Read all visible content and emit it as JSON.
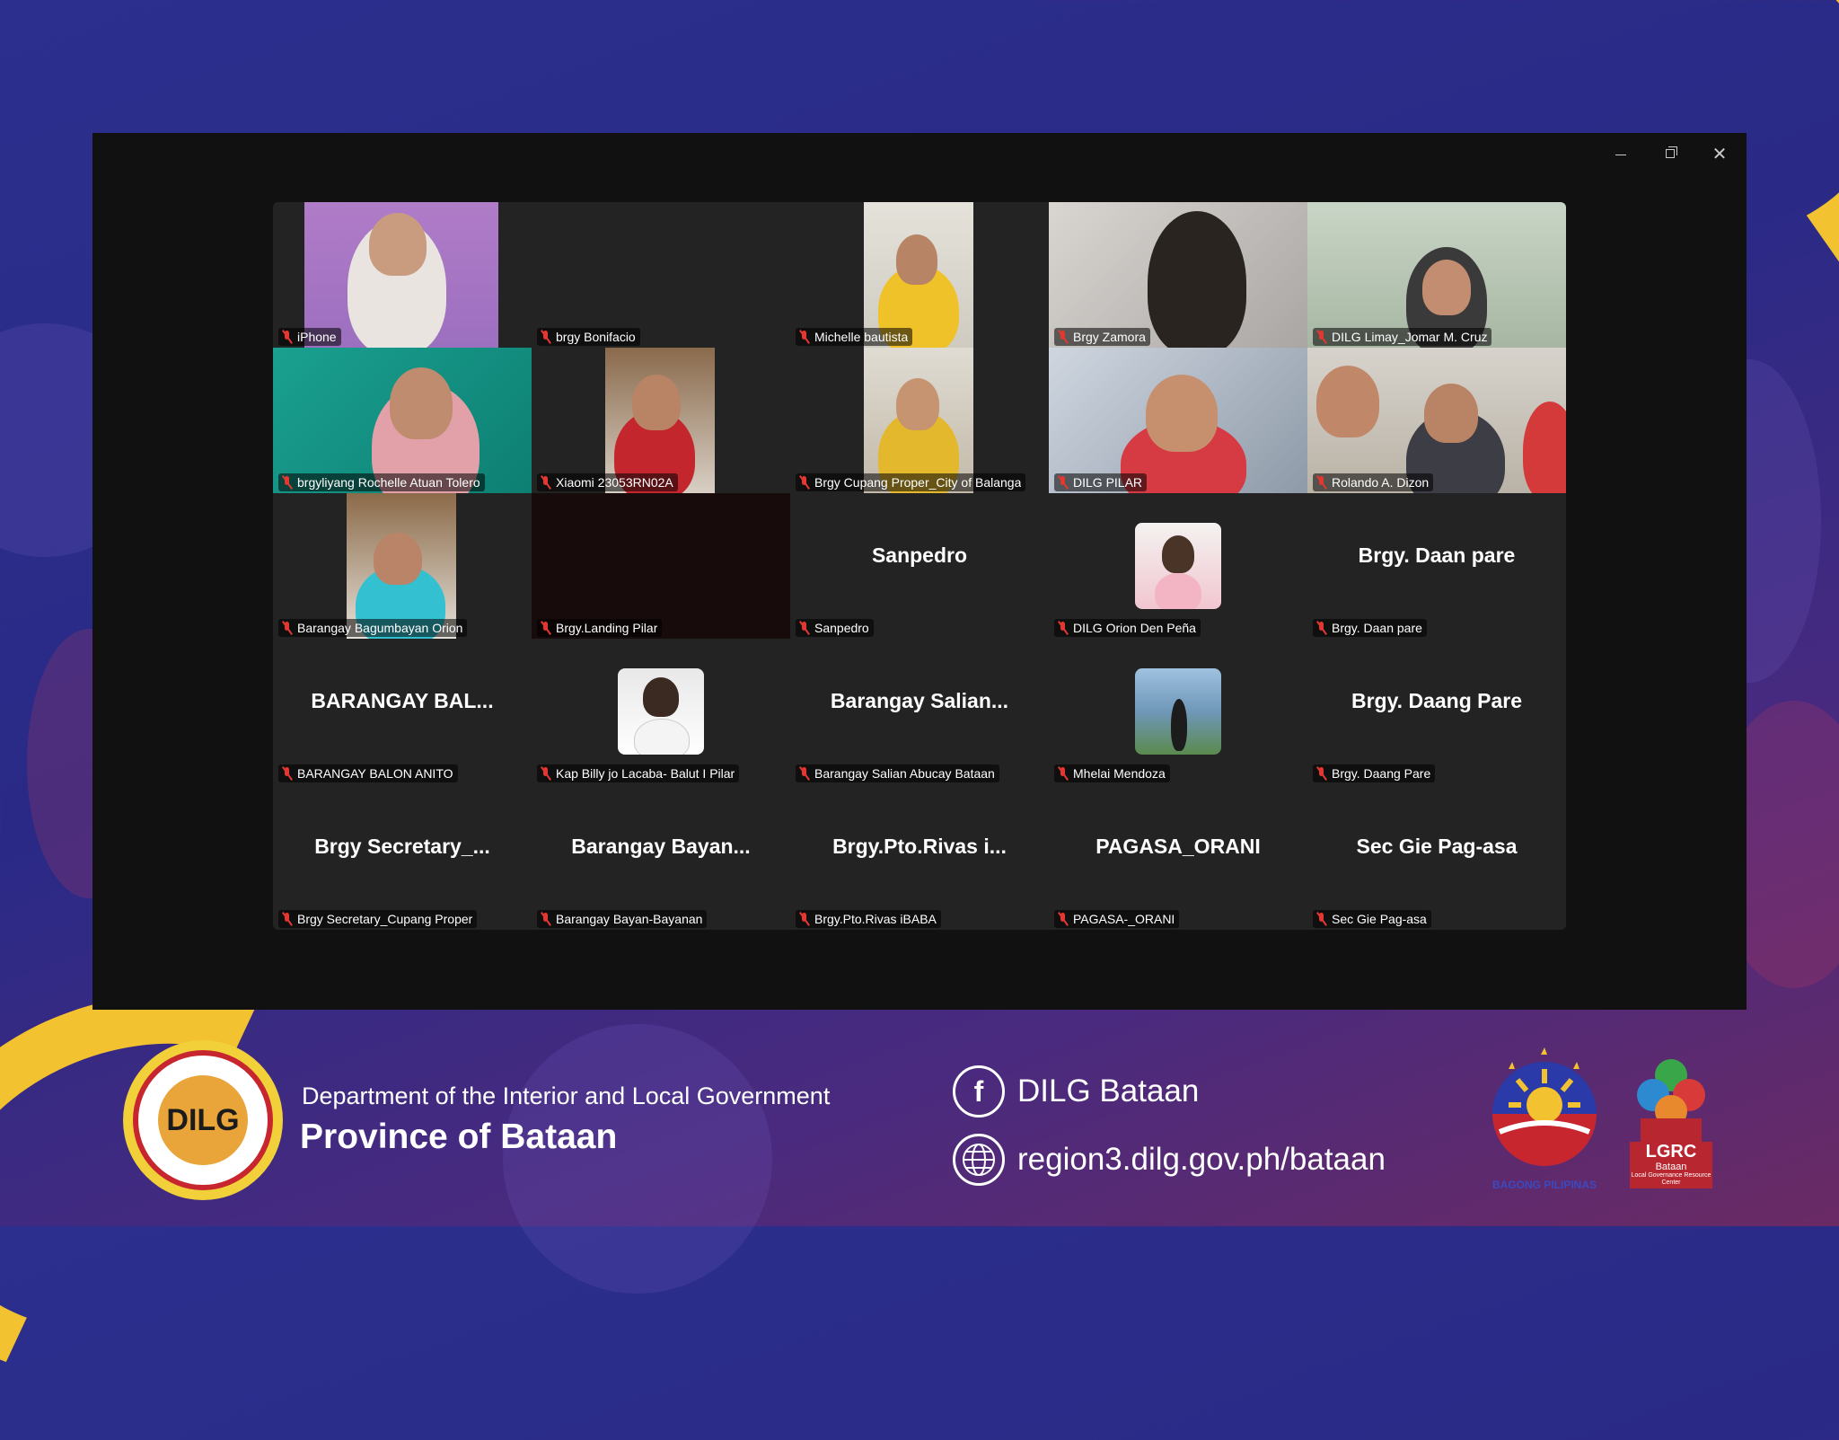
{
  "window_controls": {
    "minimize": "minimize-icon",
    "maximize": "restore-icon",
    "close": "close-icon"
  },
  "participants": [
    {
      "name": "iPhone",
      "type": "video"
    },
    {
      "name": "brgy Bonifacio",
      "type": "video-off"
    },
    {
      "name": "Michelle bautista",
      "type": "video"
    },
    {
      "name": "Brgy Zamora",
      "type": "video"
    },
    {
      "name": "DILG Limay_Jomar M. Cruz",
      "type": "video"
    },
    {
      "name": "brgyliyang Rochelle Atuan Tolero",
      "type": "video"
    },
    {
      "name": "Xiaomi 23053RN02A",
      "type": "video"
    },
    {
      "name": "Brgy Cupang Proper_City of Balanga",
      "type": "video"
    },
    {
      "name": "DILG PILAR",
      "type": "video"
    },
    {
      "name": "Rolando A. Dizon",
      "type": "video"
    },
    {
      "name": "Barangay Bagumbayan Orion",
      "type": "video"
    },
    {
      "name": "Brgy.Landing Pilar",
      "type": "video-dark"
    },
    {
      "name": "Sanpedro",
      "display": "Sanpedro",
      "type": "name"
    },
    {
      "name": "DILG Orion Den Peña",
      "type": "avatar"
    },
    {
      "name": "Brgy. Daan pare",
      "display": "Brgy. Daan pare",
      "type": "name"
    },
    {
      "name": "BARANGAY BALON ANITO",
      "display": "BARANGAY  BAL...",
      "type": "name"
    },
    {
      "name": "Kap Billy jo Lacaba- Balut I Pilar",
      "type": "avatar"
    },
    {
      "name": "Barangay Salian Abucay Bataan",
      "display": "Barangay  Salian...",
      "type": "name"
    },
    {
      "name": "Mhelai Mendoza",
      "type": "avatar"
    },
    {
      "name": "Brgy. Daang Pare",
      "display": "Brgy. Daang Pare",
      "type": "name"
    },
    {
      "name": "Brgy Secretary_Cupang Proper",
      "display": "Brgy  Secretary_...",
      "type": "name"
    },
    {
      "name": "Barangay Bayan-Bayanan",
      "display": "Barangay  Bayan...",
      "type": "name"
    },
    {
      "name": "Brgy.Pto.Rivas iBABA",
      "display": "Brgy.Pto.Rivas  i...",
      "type": "name"
    },
    {
      "name": "PAGASA-_ORANI",
      "display": "PAGASA_ORANI",
      "type": "name"
    },
    {
      "name": "Sec Gie Pag-asa",
      "display": "Sec Gie Pag-asa",
      "type": "name"
    }
  ],
  "footer": {
    "seal_text": "DILG",
    "department": "Department of the Interior and Local Government",
    "province": "Province of Bataan",
    "facebook": "DILG Bataan",
    "website": "region3.dilg.gov.ph/bataan",
    "bagong_pilipinas": "BAGONG PILIPINAS",
    "lgrc": "LGRC",
    "lgrc_sub": "Bataan",
    "lgrc_desc": "Local Governance Resource Center"
  },
  "colors": {
    "accent_yellow": "#f2c230",
    "accent_red": "#c8262f",
    "background": "#2c2f8e",
    "mic_muted": "#e2382f"
  }
}
